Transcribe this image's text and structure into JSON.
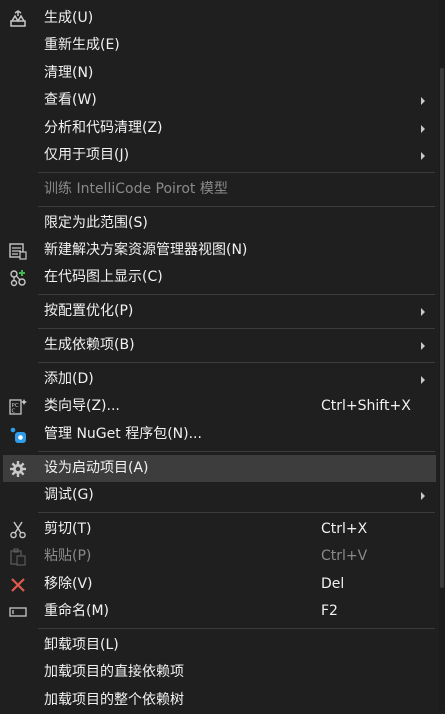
{
  "menu": {
    "items": [
      {
        "label": "生成(U)"
      },
      {
        "label": "重新生成(E)"
      },
      {
        "label": "清理(N)"
      },
      {
        "label": "查看(W)"
      },
      {
        "label": "分析和代码清理(Z)"
      },
      {
        "label": "仅用于项目(J)"
      },
      {
        "label": "训练 IntelliCode Poirot 模型"
      },
      {
        "label": "限定为此范围(S)"
      },
      {
        "label": "新建解决方案资源管理器视图(N)"
      },
      {
        "label": "在代码图上显示(C)"
      },
      {
        "label": "按配置优化(P)"
      },
      {
        "label": "生成依赖项(B)"
      },
      {
        "label": "添加(D)"
      },
      {
        "label": "类向导(Z)...",
        "shortcut": "Ctrl+Shift+X"
      },
      {
        "label": "管理 NuGet 程序包(N)..."
      },
      {
        "label": "设为启动项目(A)"
      },
      {
        "label": "调试(G)"
      },
      {
        "label": "剪切(T)",
        "shortcut": "Ctrl+X"
      },
      {
        "label": "粘贴(P)",
        "shortcut": "Ctrl+V"
      },
      {
        "label": "移除(V)",
        "shortcut": "Del"
      },
      {
        "label": "重命名(M)",
        "shortcut": "F2"
      },
      {
        "label": "卸载项目(L)"
      },
      {
        "label": "加载项目的直接依赖项"
      },
      {
        "label": "加载项目的整个依赖树"
      }
    ],
    "icons": {
      "build": "build-icon",
      "new_view": "new-view-icon",
      "code_map": "code-map-icon",
      "class_wizard": "class-wizard-icon",
      "nuget": "nuget-icon",
      "settings": "gear-icon",
      "cut": "scissors-icon",
      "paste": "paste-icon",
      "remove": "close-icon",
      "rename": "rename-icon"
    },
    "colors": {
      "background": "#1f1f1f",
      "highlight": "#3d3d3d",
      "text": "#f1f1f1",
      "disabled": "#8a8a8a",
      "remove_icon": "#e05a4e",
      "nuget_icon": "#2f9ce8"
    }
  }
}
